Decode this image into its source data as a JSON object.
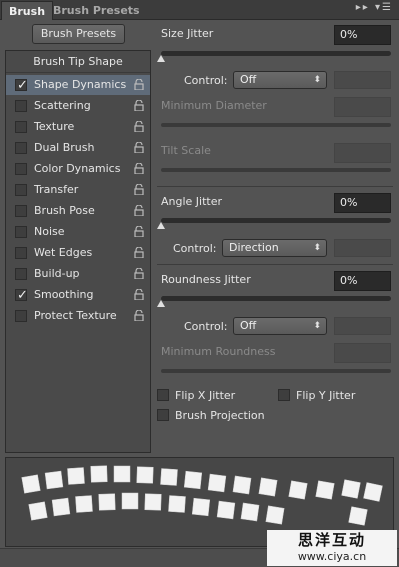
{
  "tabs": {
    "active": "Brush",
    "second": "Brush Presets",
    "icons": [
      "collapse-icon",
      "panel-menu-icon"
    ]
  },
  "brush_presets_button": "Brush Presets",
  "left_panel": {
    "header": "Brush Tip Shape",
    "options": [
      {
        "label": "Shape Dynamics",
        "checked": true,
        "selected": true
      },
      {
        "label": "Scattering",
        "checked": false
      },
      {
        "label": "Texture",
        "checked": false
      },
      {
        "label": "Dual Brush",
        "checked": false
      },
      {
        "label": "Color Dynamics",
        "checked": false
      },
      {
        "label": "Transfer",
        "checked": false
      },
      {
        "label": "Brush Pose",
        "checked": false
      },
      {
        "label": "Noise",
        "checked": false
      },
      {
        "label": "Wet Edges",
        "checked": false
      },
      {
        "label": "Build-up",
        "checked": false
      },
      {
        "label": "Smoothing",
        "checked": true
      },
      {
        "label": "Protect Texture",
        "checked": false
      }
    ]
  },
  "size_jitter": {
    "label": "Size Jitter",
    "value": "0%",
    "level": 0
  },
  "size_control": {
    "label": "Control:",
    "value": "Off"
  },
  "min_diameter": {
    "label": "Minimum Diameter"
  },
  "tilt_scale": {
    "label": "Tilt Scale"
  },
  "angle_jitter": {
    "label": "Angle Jitter",
    "value": "0%",
    "level": 0
  },
  "angle_control": {
    "label": "Control:",
    "value": "Direction"
  },
  "roundness_jitter": {
    "label": "Roundness Jitter",
    "value": "0%",
    "level": 0
  },
  "roundness_control": {
    "label": "Control:",
    "value": "Off"
  },
  "min_roundness": {
    "label": "Minimum Roundness"
  },
  "checkboxes": {
    "flip_x": "Flip X Jitter",
    "flip_y": "Flip Y Jitter",
    "projection": "Brush Projection"
  },
  "watermark": {
    "line1": "思洋互动",
    "line2": "www.ciya.cn"
  },
  "colors": {
    "panel": "#535353",
    "selected": "#5f6b79",
    "field": "#2a2a2a"
  }
}
